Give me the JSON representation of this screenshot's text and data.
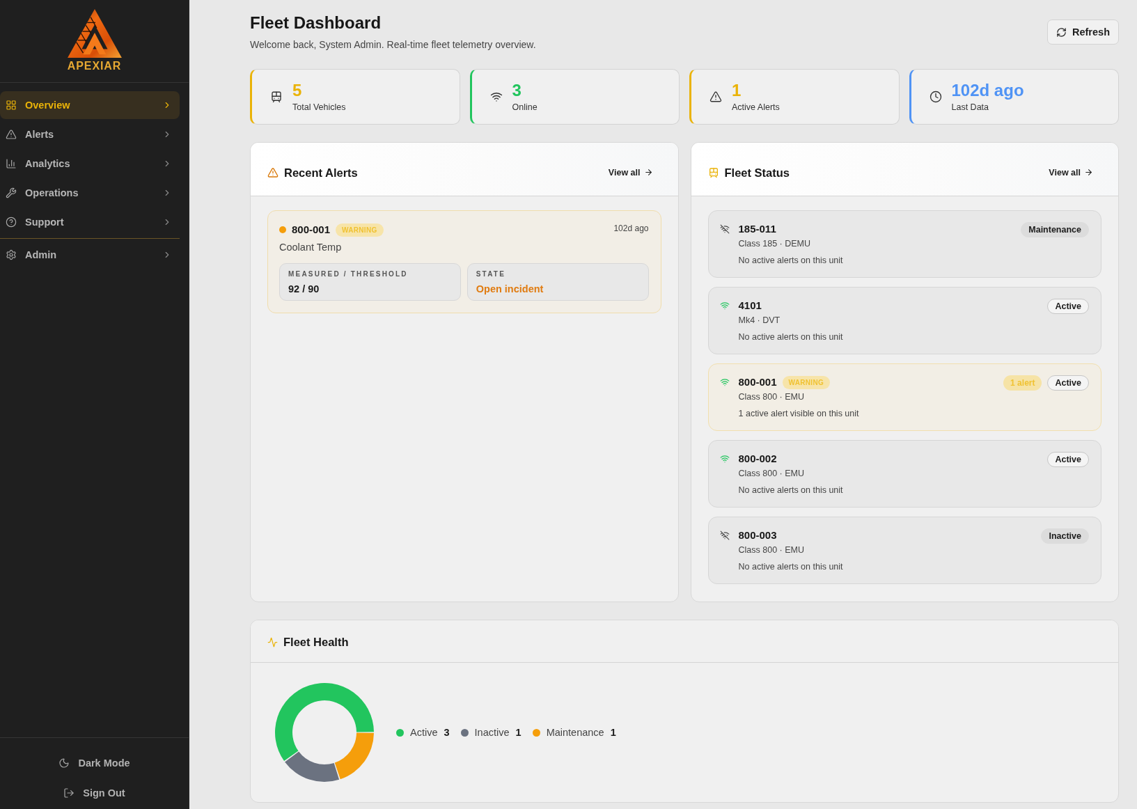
{
  "sidebar": {
    "logo": {
      "text": "APEXIAR"
    },
    "nav_groups": [
      {
        "items": [
          {
            "label": "Overview",
            "kind": "dashboard",
            "selected": true
          },
          {
            "label": "Alerts",
            "kind": "alerts",
            "selected": false
          },
          {
            "label": "Analytics",
            "kind": "analytics",
            "selected": false
          },
          {
            "label": "Operations",
            "kind": "operations",
            "selected": false
          },
          {
            "label": "Support",
            "kind": "support",
            "selected": false
          }
        ]
      },
      {
        "items": [
          {
            "label": "Admin",
            "kind": "admin",
            "selected": false
          }
        ]
      }
    ],
    "footer": [
      {
        "label": "Dark Mode",
        "kind": "theme"
      },
      {
        "label": "Sign Out",
        "kind": "logout"
      }
    ]
  },
  "header": {
    "title": "Fleet Dashboard",
    "subtitle": "Welcome back, System Admin. Real-time fleet telemetry overview.",
    "refresh": "Refresh"
  },
  "stats": [
    {
      "value": "5",
      "label": "Total Vehicles",
      "kind": "vehicles",
      "color": "#eab308"
    },
    {
      "value": "3",
      "label": "Online",
      "kind": "online",
      "color": "#22c55e"
    },
    {
      "value": "1",
      "label": "Active Alerts",
      "kind": "alerts",
      "color": "#eab308"
    },
    {
      "value": "102d ago",
      "label": "Last Data",
      "kind": "time",
      "color": "#4f93f5"
    }
  ],
  "recent_alerts": {
    "title": "Recent Alerts",
    "link": "View all",
    "alerts": [
      {
        "unit": "800-001",
        "severity": {
          "label": "WARNING",
          "kind": "warning"
        },
        "time": "102d ago",
        "metric": "Coolant Temp",
        "fields": [
          {
            "label": "MEASURED / THRESHOLD",
            "value": "92 / 90",
            "kind": "plain"
          },
          {
            "label": "STATE",
            "value": "Open incident",
            "kind": "accent"
          }
        ]
      }
    ]
  },
  "fleet_status": {
    "title": "Fleet Status",
    "link": "View all",
    "units": [
      {
        "unit": "185-011",
        "online": false,
        "flagged": false,
        "detail": "Class 185 · DEMU",
        "note": "No active alerts on this unit",
        "status": {
          "label": "Maintenance",
          "kind": "maintenance"
        }
      },
      {
        "unit": "4101",
        "online": true,
        "flagged": false,
        "detail": "Mk4 · DVT",
        "note": "No active alerts on this unit",
        "status": {
          "label": "Active",
          "kind": "active"
        }
      },
      {
        "unit": "800-001",
        "online": true,
        "flagged": true,
        "severity": {
          "label": "WARNING",
          "kind": "warning"
        },
        "alert_count": "1 alert",
        "detail": "Class 800 · EMU",
        "note": "1 active alert visible on this unit",
        "status": {
          "label": "Active",
          "kind": "active"
        }
      },
      {
        "unit": "800-002",
        "online": true,
        "flagged": false,
        "detail": "Class 800 · EMU",
        "note": "No active alerts on this unit",
        "status": {
          "label": "Active",
          "kind": "active"
        }
      },
      {
        "unit": "800-003",
        "online": false,
        "flagged": false,
        "detail": "Class 800 · EMU",
        "note": "No active alerts on this unit",
        "status": {
          "label": "Inactive",
          "kind": "inactive"
        }
      }
    ]
  },
  "fleet_health": {
    "title": "Fleet Health",
    "chart_data": {
      "type": "donut",
      "categories": [
        "Active",
        "Inactive",
        "Maintenance"
      ],
      "values": [
        60,
        20,
        20
      ]
    },
    "legend": [
      {
        "count": "3",
        "color": "#22c55e"
      },
      {
        "count": "1",
        "color": "#6b7280"
      },
      {
        "count": "1",
        "color": "#f59e0b"
      }
    ]
  }
}
